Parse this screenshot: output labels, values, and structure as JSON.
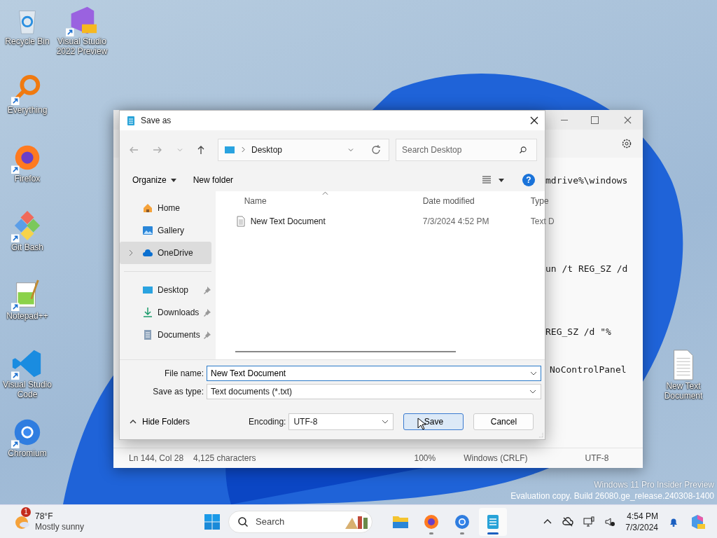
{
  "desktop_icons": [
    {
      "label": "Recycle Bin",
      "kind": "recycle",
      "shortcut": false
    },
    {
      "label": "Visual Studio 2022 Preview",
      "kind": "vs",
      "shortcut": true
    },
    {
      "label": "Everything",
      "kind": "everything",
      "shortcut": true
    },
    {
      "label": "Firefox",
      "kind": "firefox",
      "shortcut": true
    },
    {
      "label": "Git Bash",
      "kind": "git",
      "shortcut": true
    },
    {
      "label": "Notepad++",
      "kind": "notepadpp",
      "shortcut": true
    },
    {
      "label": "Visual Studio Code",
      "kind": "vscode",
      "shortcut": true
    },
    {
      "label": "Chromium",
      "kind": "chromium",
      "shortcut": true
    }
  ],
  "desktop_file": {
    "label": "New Text Document"
  },
  "notepad": {
    "text_lines": [
      "mdrive%\\windows",
      "un /t REG_SZ /d",
      "REG_SZ /d \"%",
      "NoControlPanel"
    ],
    "status_bar": [
      "Ln 144, Col 28",
      "4,125 characters",
      "100%",
      "Windows (CRLF)",
      "UTF-8"
    ]
  },
  "dialog": {
    "title": "Save as",
    "address": "Desktop",
    "search_placeholder": "Search Desktop",
    "commands": {
      "organize": "Organize",
      "new_folder": "New folder"
    },
    "help_glyph": "?",
    "nav_groups": [
      [
        {
          "label": "Home",
          "kind": "home",
          "pinned": false,
          "selected": false,
          "expandable": false
        },
        {
          "label": "Gallery",
          "kind": "gallery",
          "pinned": false,
          "selected": false,
          "expandable": false
        },
        {
          "label": "OneDrive",
          "kind": "cloud",
          "pinned": false,
          "selected": true,
          "expandable": true
        }
      ],
      [
        {
          "label": "Desktop",
          "kind": "desktop",
          "pinned": true,
          "selected": false,
          "expandable": false
        },
        {
          "label": "Downloads",
          "kind": "download",
          "pinned": true,
          "selected": false,
          "expandable": false
        },
        {
          "label": "Documents",
          "kind": "documents",
          "pinned": true,
          "selected": false,
          "expandable": false
        }
      ]
    ],
    "columns": [
      "Name",
      "Date modified",
      "Type"
    ],
    "files": [
      {
        "name": "New Text Document",
        "date_modified": "7/3/2024 4:52 PM",
        "type": "Text D"
      }
    ],
    "file_name_label": "File name:",
    "file_name": "New Text Document",
    "save_type_label": "Save as type:",
    "save_type": "Text documents (*.txt)",
    "hide_folders": "Hide Folders",
    "encoding_label": "Encoding:",
    "encoding": "UTF-8",
    "buttons": [
      {
        "label": "Save",
        "kind": "primary"
      },
      {
        "label": "Cancel",
        "kind": "secondary"
      }
    ]
  },
  "watermark": [
    "Windows 11 Pro Insider Preview",
    "Evaluation copy. Build 26080.ge_release.240308-1400"
  ],
  "taskbar": {
    "weather": {
      "temp": "78°F",
      "condition": "Mostly sunny",
      "badge": "1"
    },
    "search": "Search",
    "apps": [
      {
        "kind": "explorer",
        "active": false,
        "running": false
      },
      {
        "kind": "firefox",
        "active": false,
        "running": true
      },
      {
        "kind": "chromium",
        "active": false,
        "running": true
      },
      {
        "kind": "notepad",
        "active": true,
        "running": true
      }
    ],
    "time": "4:54 PM",
    "date": "7/3/2024"
  }
}
